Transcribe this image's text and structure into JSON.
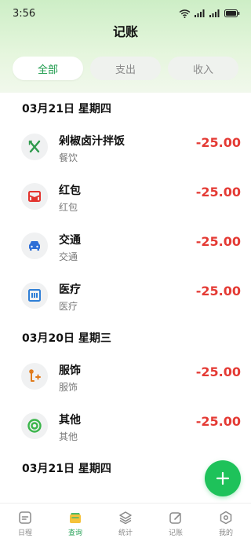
{
  "status_bar": {
    "time": "3:56"
  },
  "header": {
    "title": "记账"
  },
  "tabs": [
    {
      "label": "全部",
      "active": true
    },
    {
      "label": "支出",
      "active": false
    },
    {
      "label": "收入",
      "active": false
    }
  ],
  "groups": [
    {
      "date": "03月21日 星期四",
      "items": [
        {
          "name": "剁椒卤汁拌饭",
          "category": "餐饮",
          "amount": "-25.00",
          "icon": "fork-knife-icon"
        },
        {
          "name": "红包",
          "category": "红包",
          "amount": "-25.00",
          "icon": "red-envelope-icon"
        },
        {
          "name": "交通",
          "category": "交通",
          "amount": "-25.00",
          "icon": "car-icon"
        },
        {
          "name": "医疗",
          "category": "医疗",
          "amount": "-25.00",
          "icon": "medical-icon"
        }
      ]
    },
    {
      "date": "03月20日 星期三",
      "items": [
        {
          "name": "服饰",
          "category": "服饰",
          "amount": "-25.00",
          "icon": "clothing-icon"
        },
        {
          "name": "其他",
          "category": "其他",
          "amount": "-25.00",
          "icon": "circle-target-icon"
        }
      ]
    },
    {
      "date": "03月21日 星期四",
      "items": []
    }
  ],
  "bottom_nav": [
    {
      "label": "日程",
      "icon": "schedule-icon",
      "active": false
    },
    {
      "label": "查询",
      "icon": "query-icon",
      "active": true
    },
    {
      "label": "统计",
      "icon": "layers-icon",
      "active": false
    },
    {
      "label": "记账",
      "icon": "edit-icon",
      "active": false
    },
    {
      "label": "我的",
      "icon": "profile-icon",
      "active": false
    }
  ],
  "colors": {
    "accent_green": "#1ec25a",
    "expense_red": "#e43a34",
    "header_gradient_top": "#cdeec6"
  }
}
